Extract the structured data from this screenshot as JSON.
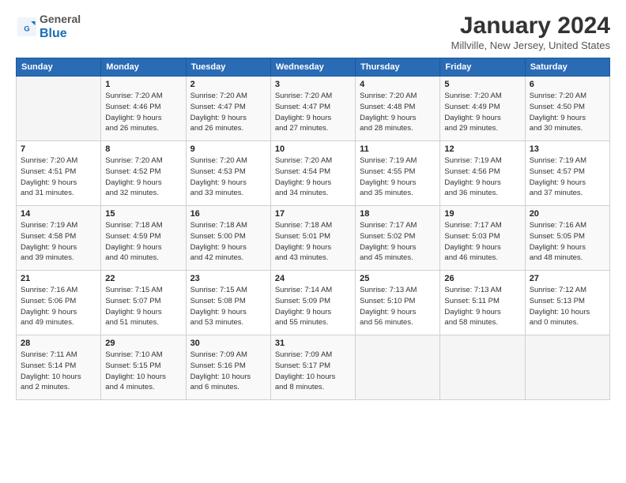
{
  "header": {
    "logo_line1": "General",
    "logo_line2": "Blue",
    "title": "January 2024",
    "location": "Millville, New Jersey, United States"
  },
  "days_of_week": [
    "Sunday",
    "Monday",
    "Tuesday",
    "Wednesday",
    "Thursday",
    "Friday",
    "Saturday"
  ],
  "weeks": [
    [
      {
        "day": "",
        "info": ""
      },
      {
        "day": "1",
        "info": "Sunrise: 7:20 AM\nSunset: 4:46 PM\nDaylight: 9 hours\nand 26 minutes."
      },
      {
        "day": "2",
        "info": "Sunrise: 7:20 AM\nSunset: 4:47 PM\nDaylight: 9 hours\nand 26 minutes."
      },
      {
        "day": "3",
        "info": "Sunrise: 7:20 AM\nSunset: 4:47 PM\nDaylight: 9 hours\nand 27 minutes."
      },
      {
        "day": "4",
        "info": "Sunrise: 7:20 AM\nSunset: 4:48 PM\nDaylight: 9 hours\nand 28 minutes."
      },
      {
        "day": "5",
        "info": "Sunrise: 7:20 AM\nSunset: 4:49 PM\nDaylight: 9 hours\nand 29 minutes."
      },
      {
        "day": "6",
        "info": "Sunrise: 7:20 AM\nSunset: 4:50 PM\nDaylight: 9 hours\nand 30 minutes."
      }
    ],
    [
      {
        "day": "7",
        "info": "Sunrise: 7:20 AM\nSunset: 4:51 PM\nDaylight: 9 hours\nand 31 minutes."
      },
      {
        "day": "8",
        "info": "Sunrise: 7:20 AM\nSunset: 4:52 PM\nDaylight: 9 hours\nand 32 minutes."
      },
      {
        "day": "9",
        "info": "Sunrise: 7:20 AM\nSunset: 4:53 PM\nDaylight: 9 hours\nand 33 minutes."
      },
      {
        "day": "10",
        "info": "Sunrise: 7:20 AM\nSunset: 4:54 PM\nDaylight: 9 hours\nand 34 minutes."
      },
      {
        "day": "11",
        "info": "Sunrise: 7:19 AM\nSunset: 4:55 PM\nDaylight: 9 hours\nand 35 minutes."
      },
      {
        "day": "12",
        "info": "Sunrise: 7:19 AM\nSunset: 4:56 PM\nDaylight: 9 hours\nand 36 minutes."
      },
      {
        "day": "13",
        "info": "Sunrise: 7:19 AM\nSunset: 4:57 PM\nDaylight: 9 hours\nand 37 minutes."
      }
    ],
    [
      {
        "day": "14",
        "info": "Sunrise: 7:19 AM\nSunset: 4:58 PM\nDaylight: 9 hours\nand 39 minutes."
      },
      {
        "day": "15",
        "info": "Sunrise: 7:18 AM\nSunset: 4:59 PM\nDaylight: 9 hours\nand 40 minutes."
      },
      {
        "day": "16",
        "info": "Sunrise: 7:18 AM\nSunset: 5:00 PM\nDaylight: 9 hours\nand 42 minutes."
      },
      {
        "day": "17",
        "info": "Sunrise: 7:18 AM\nSunset: 5:01 PM\nDaylight: 9 hours\nand 43 minutes."
      },
      {
        "day": "18",
        "info": "Sunrise: 7:17 AM\nSunset: 5:02 PM\nDaylight: 9 hours\nand 45 minutes."
      },
      {
        "day": "19",
        "info": "Sunrise: 7:17 AM\nSunset: 5:03 PM\nDaylight: 9 hours\nand 46 minutes."
      },
      {
        "day": "20",
        "info": "Sunrise: 7:16 AM\nSunset: 5:05 PM\nDaylight: 9 hours\nand 48 minutes."
      }
    ],
    [
      {
        "day": "21",
        "info": "Sunrise: 7:16 AM\nSunset: 5:06 PM\nDaylight: 9 hours\nand 49 minutes."
      },
      {
        "day": "22",
        "info": "Sunrise: 7:15 AM\nSunset: 5:07 PM\nDaylight: 9 hours\nand 51 minutes."
      },
      {
        "day": "23",
        "info": "Sunrise: 7:15 AM\nSunset: 5:08 PM\nDaylight: 9 hours\nand 53 minutes."
      },
      {
        "day": "24",
        "info": "Sunrise: 7:14 AM\nSunset: 5:09 PM\nDaylight: 9 hours\nand 55 minutes."
      },
      {
        "day": "25",
        "info": "Sunrise: 7:13 AM\nSunset: 5:10 PM\nDaylight: 9 hours\nand 56 minutes."
      },
      {
        "day": "26",
        "info": "Sunrise: 7:13 AM\nSunset: 5:11 PM\nDaylight: 9 hours\nand 58 minutes."
      },
      {
        "day": "27",
        "info": "Sunrise: 7:12 AM\nSunset: 5:13 PM\nDaylight: 10 hours\nand 0 minutes."
      }
    ],
    [
      {
        "day": "28",
        "info": "Sunrise: 7:11 AM\nSunset: 5:14 PM\nDaylight: 10 hours\nand 2 minutes."
      },
      {
        "day": "29",
        "info": "Sunrise: 7:10 AM\nSunset: 5:15 PM\nDaylight: 10 hours\nand 4 minutes."
      },
      {
        "day": "30",
        "info": "Sunrise: 7:09 AM\nSunset: 5:16 PM\nDaylight: 10 hours\nand 6 minutes."
      },
      {
        "day": "31",
        "info": "Sunrise: 7:09 AM\nSunset: 5:17 PM\nDaylight: 10 hours\nand 8 minutes."
      },
      {
        "day": "",
        "info": ""
      },
      {
        "day": "",
        "info": ""
      },
      {
        "day": "",
        "info": ""
      }
    ]
  ]
}
